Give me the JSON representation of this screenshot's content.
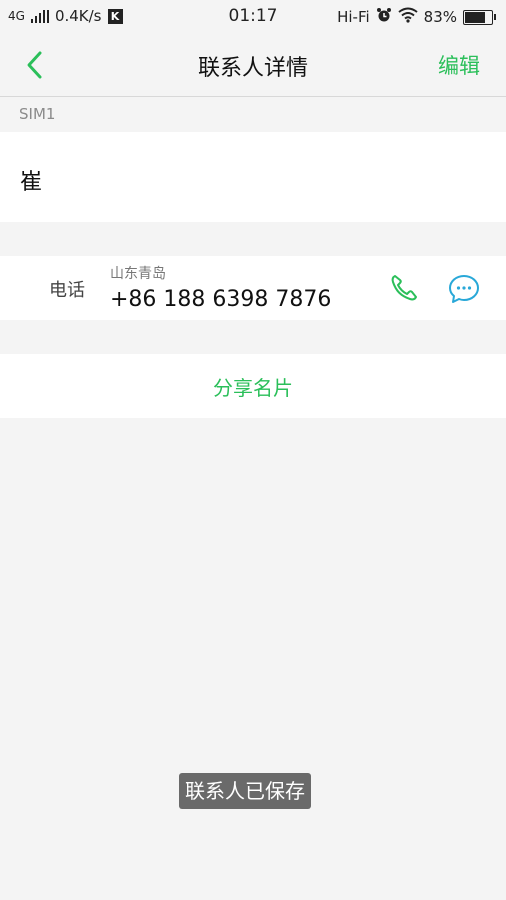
{
  "status_bar": {
    "network": "4G",
    "speed": "0.4K/s",
    "app_badge": "K",
    "time": "01:17",
    "hifi": "Hi-Fi",
    "battery": "83%",
    "battery_level": 0.83
  },
  "nav": {
    "title": "联系人详情",
    "edit_label": "编辑",
    "accent_color": "#2bbf5a"
  },
  "contact": {
    "sim_label": "SIM1",
    "name": "崔",
    "phone": {
      "type_label": "电话",
      "location": "山东青岛",
      "number": "+86 188 6398 7876"
    },
    "share_label": "分享名片"
  },
  "toast": {
    "text": "联系人已保存"
  },
  "icons": [
    "back-icon",
    "phone-icon",
    "message-icon",
    "alarm-icon",
    "wifi-icon",
    "battery-icon",
    "signal-icon"
  ]
}
